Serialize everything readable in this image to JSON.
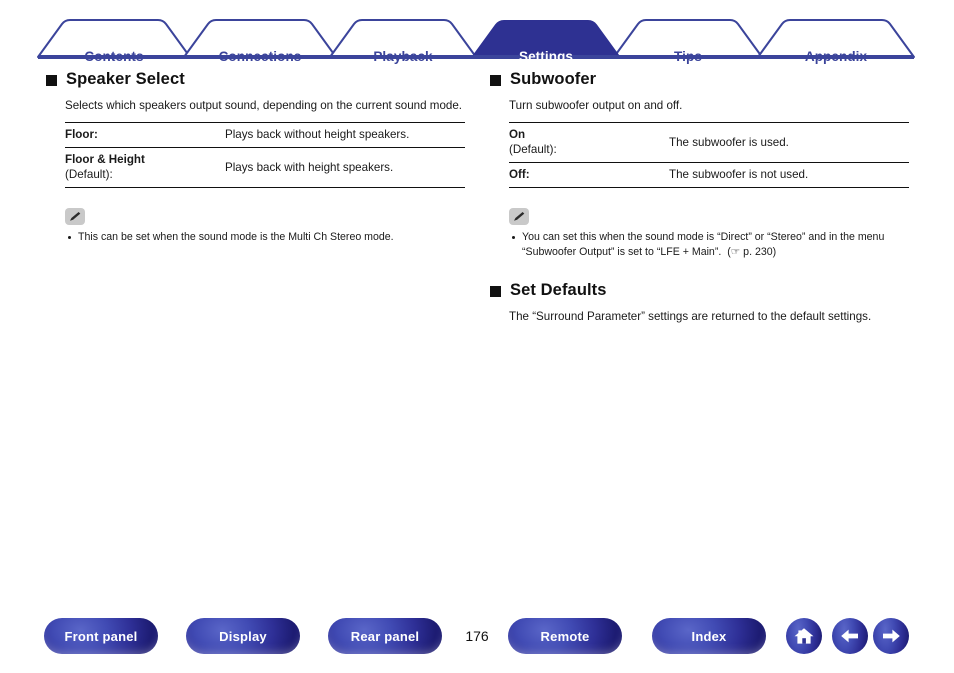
{
  "tabs": [
    {
      "label": "Contents",
      "active": false
    },
    {
      "label": "Connections",
      "active": false
    },
    {
      "label": "Playback",
      "active": false
    },
    {
      "label": "Settings",
      "active": true
    },
    {
      "label": "Tips",
      "active": false
    },
    {
      "label": "Appendix",
      "active": false
    }
  ],
  "colors": {
    "tab_accent": "#3b449b",
    "tab_active_fill": "#2e3192",
    "button_blue": "#2e2f96",
    "note_icon_bg": "#c9c9c9",
    "rule": "#111111"
  },
  "left_column": {
    "section": {
      "title": "Speaker Select",
      "marker": "filled-square",
      "intro": "Selects which speakers output sound, depending on the current sound mode.",
      "table": {
        "rows": [
          {
            "option": "Floor:",
            "default_note": "",
            "description": "Plays back without height speakers."
          },
          {
            "option": "Floor & Height",
            "default_note": "(Default):",
            "description": "Plays back with height speakers."
          }
        ]
      }
    },
    "note": {
      "icon": "pencil-note-icon",
      "items": [
        "This can be set when the sound mode is the Multi Ch Stereo mode."
      ]
    }
  },
  "right_column": {
    "section_subwoofer": {
      "title": "Subwoofer",
      "marker": "filled-square",
      "intro": "Turn subwoofer output on and off.",
      "table": {
        "rows": [
          {
            "option": "On",
            "default_note": "(Default):",
            "description": "The subwoofer is used."
          },
          {
            "option": "Off:",
            "default_note": "",
            "description": "The subwoofer is not used."
          }
        ]
      }
    },
    "note": {
      "icon": "pencil-note-icon",
      "items": [
        {
          "text_before": "You can set this when the sound mode is “Direct” or “Stereo” and in the menu “Subwoofer Output” is set to “LFE + Main”.",
          "page_ref": "(☞ p. 230)"
        }
      ]
    },
    "section_set_defaults": {
      "title": "Set Defaults",
      "marker": "filled-square",
      "intro": "The “Surround Parameter” settings are returned to the default settings."
    }
  },
  "footer": {
    "buttons": [
      {
        "label": "Front panel"
      },
      {
        "label": "Display"
      },
      {
        "label": "Rear panel"
      },
      {
        "label": "Remote"
      },
      {
        "label": "Index"
      }
    ],
    "page_number": "176",
    "icon_buttons": [
      {
        "icon": "home-icon"
      },
      {
        "icon": "arrow-left-icon"
      },
      {
        "icon": "arrow-right-icon"
      }
    ]
  }
}
